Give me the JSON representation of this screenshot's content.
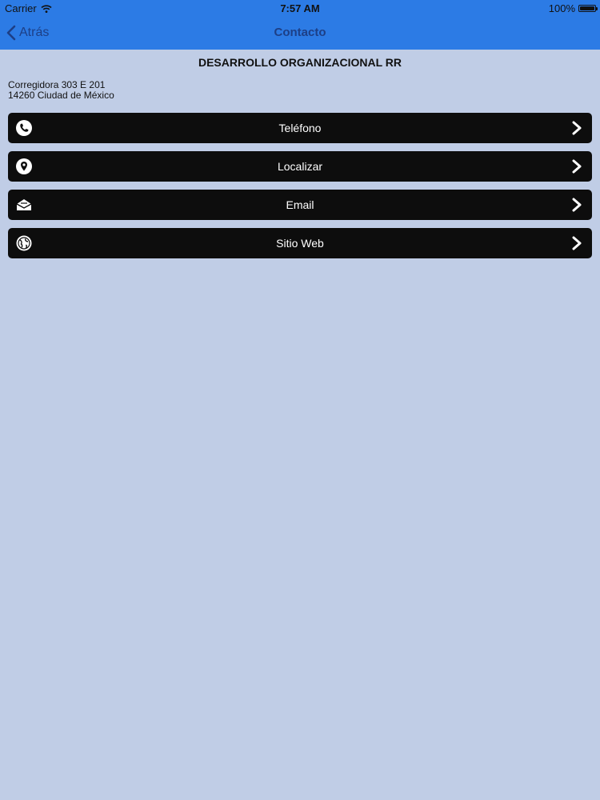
{
  "status_bar": {
    "carrier": "Carrier",
    "time": "7:57 AM",
    "battery": "100%"
  },
  "nav": {
    "back_label": "Atrás",
    "title": "Contacto"
  },
  "organization": {
    "name": "DESARROLLO ORGANIZACIONAL RR",
    "address_line1": "Corregidora 303 E 201",
    "address_line2": "14260 Ciudad de México"
  },
  "menu": {
    "phone": "Teléfono",
    "locate": "Localizar",
    "email": "Email",
    "website": "Sitio Web"
  },
  "colors": {
    "nav_background": "#2c7be5",
    "page_background": "#c0cde6",
    "row_background": "#0d0d0d",
    "nav_text": "#1d3f86"
  }
}
